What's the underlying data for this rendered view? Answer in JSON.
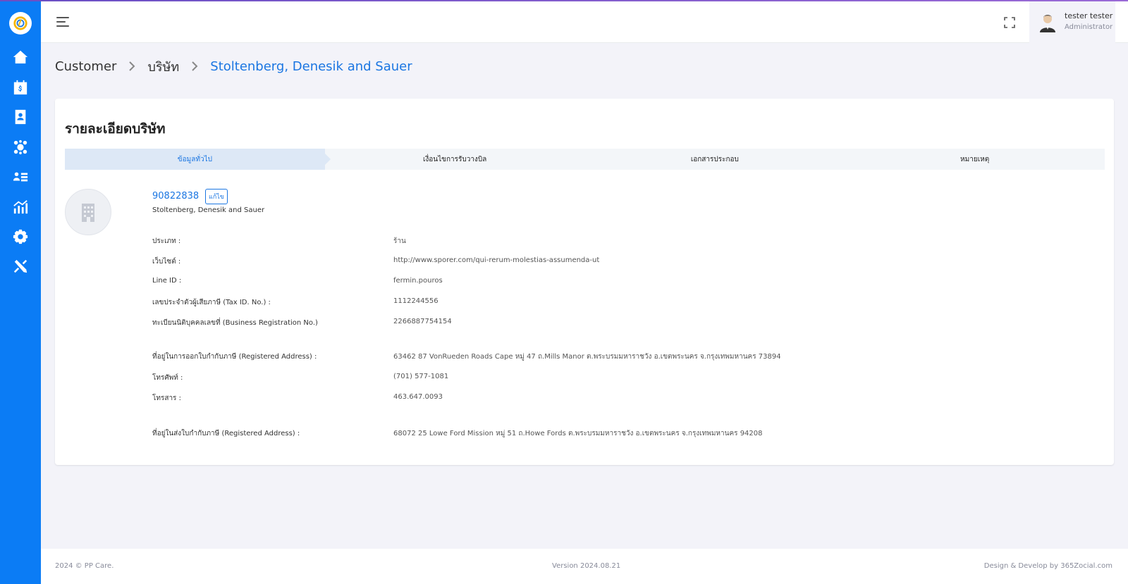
{
  "sidebar": {
    "logo": "pp-care-logo",
    "items": [
      {
        "name": "home-icon"
      },
      {
        "name": "billing-calendar-icon"
      },
      {
        "name": "contacts-icon"
      },
      {
        "name": "team-icon"
      },
      {
        "name": "user-list-icon"
      },
      {
        "name": "analytics-icon"
      },
      {
        "name": "settings-icon"
      },
      {
        "name": "tools-icon"
      }
    ]
  },
  "header": {
    "user_name": "tester tester",
    "user_role": "Administrator"
  },
  "breadcrumb": {
    "items": [
      "Customer",
      "บริษัท"
    ],
    "current": "Stoltenberg, Denesik and Sauer"
  },
  "card": {
    "title": "รายละเอียดบริษัท",
    "tabs": [
      "ข้อมูลทั่วไป",
      "เงื่อนไขการรับวางบิล",
      "เอกสารประกอบ",
      "หมายเหตุ"
    ],
    "active_tab": 0,
    "company_code": "90822838",
    "edit_label": "แก้ไข",
    "company_name": "Stoltenberg, Denesik and Sauer",
    "fields": [
      {
        "label": "ประเภท :",
        "value": "ร้าน"
      },
      {
        "label": "เว็บไซต์ :",
        "value": "http://www.sporer.com/qui-rerum-molestias-assumenda-ut"
      },
      {
        "label": "Line ID :",
        "value": "fermin.pouros"
      },
      {
        "label": "เลขประจำตัวผู้เสียภาษี (Tax ID. No.) :",
        "value": "1112244556"
      },
      {
        "label": "ทะเบียนนิติบุคคลเลขที่ (Business Registration No.)",
        "value": "2266887754154"
      },
      {
        "label": "ที่อยู่ในการออกใบกำกับภาษี (Registered Address) :",
        "value": "63462 87 VonRueden Roads Cape หมู่ 47 ถ.Mills Manor ต.พระบรมมหาราชวัง อ.เขตพระนคร จ.กรุงเทพมหานคร 73894"
      },
      {
        "label": "โทรศัพท์ :",
        "value": "(701) 577-1081"
      },
      {
        "label": "โทรสาร :",
        "value": "463.647.0093"
      },
      {
        "label": "ที่อยู่ในส่งใบกำกับภาษี (Registered Address) :",
        "value": "68072 25 Lowe Ford Mission หมู่ 51 ถ.Howe Fords ต.พระบรมมหาราชวัง อ.เขตพระนคร จ.กรุงเทพมหานคร 94208"
      }
    ]
  },
  "footer": {
    "copyright": "2024 © PP Care.",
    "version": "Version 2024.08.21",
    "credit": "Design & Develop by 365Zocial.com"
  },
  "colors": {
    "sidebar": "#0b7cf5",
    "accent": "#1b76e2",
    "background": "#f3f3f9",
    "active_tab": "#dde8f6"
  }
}
